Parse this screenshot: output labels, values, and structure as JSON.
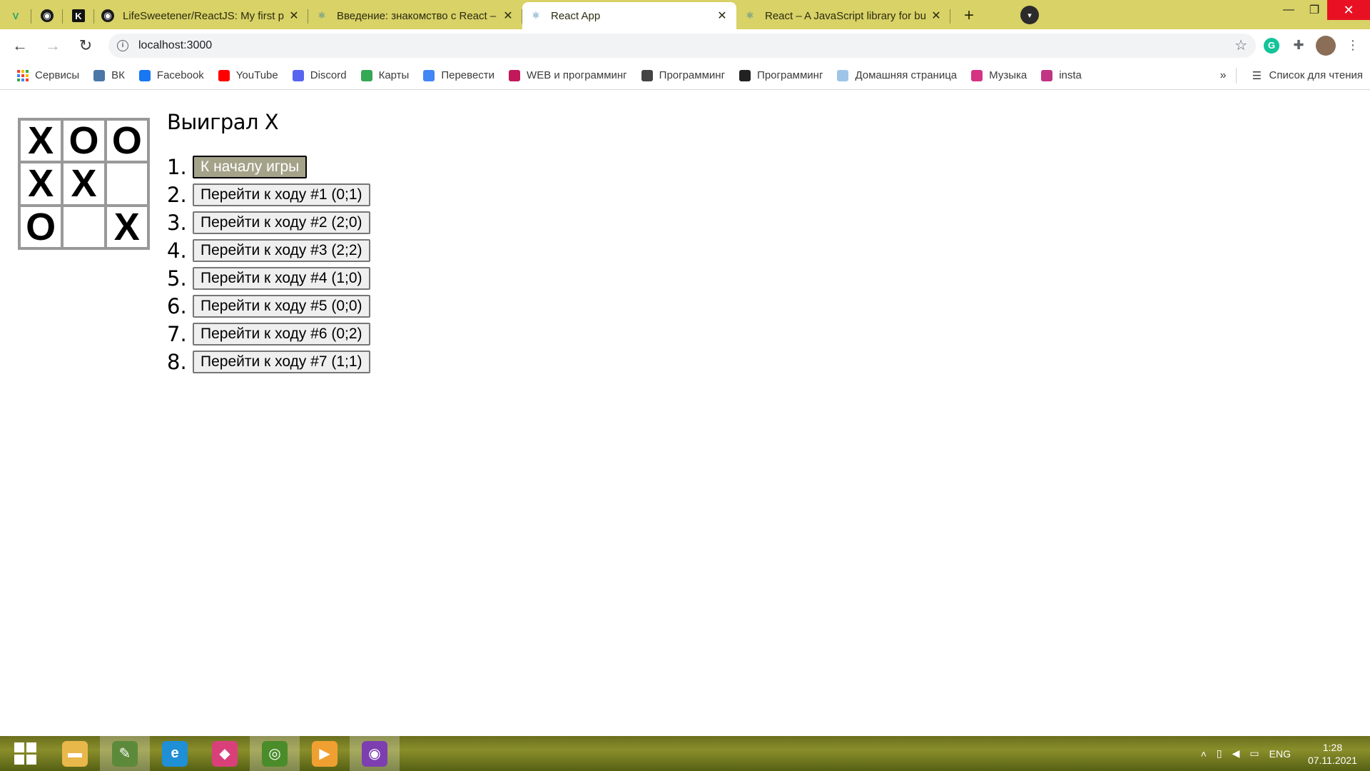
{
  "browser": {
    "tabs": [
      {
        "kind": "pinned",
        "icon": "vuetify-icon",
        "glyph": "V"
      },
      {
        "kind": "pinned",
        "icon": "github-icon",
        "glyph": "◉"
      },
      {
        "kind": "pinned",
        "icon": "kinopoisk-icon",
        "glyph": "K"
      },
      {
        "kind": "normal",
        "icon": "github-icon",
        "glyph": "◉",
        "title": "LifeSweetener/ReactJS: My first p",
        "active": false
      },
      {
        "kind": "normal",
        "icon": "react-icon",
        "glyph": "⚛",
        "title": "Введение: знакомство с React –",
        "active": false
      },
      {
        "kind": "normal",
        "icon": "react-icon",
        "glyph": "⚛",
        "title": "React App",
        "active": true
      },
      {
        "kind": "normal",
        "icon": "react-icon",
        "glyph": "⚛",
        "title": "React – A JavaScript library for bu",
        "active": false
      }
    ],
    "close_glyph": "✕",
    "new_tab_glyph": "+",
    "window": {
      "minimize": "—",
      "restore": "❐",
      "close": "✕"
    },
    "profile_glyph": "▾",
    "address": {
      "url": "localhost:3000"
    },
    "nav": {
      "back": "←",
      "forward": "→",
      "reload": "↻"
    },
    "bookmarks": [
      {
        "icon": "apps-icon",
        "label": "Сервисы",
        "color": "#4285f4"
      },
      {
        "icon": "vk-icon",
        "label": "ВК",
        "color": "#4a76a8"
      },
      {
        "icon": "facebook-icon",
        "label": "Facebook",
        "color": "#1877f2"
      },
      {
        "icon": "youtube-icon",
        "label": "YouTube",
        "color": "#ff0000"
      },
      {
        "icon": "discord-icon",
        "label": "Discord",
        "color": "#5865f2"
      },
      {
        "icon": "maps-icon",
        "label": "Карты",
        "color": "#34a853"
      },
      {
        "icon": "translate-icon",
        "label": "Перевести",
        "color": "#4285f4"
      },
      {
        "icon": "folder-icon",
        "label": "WEB и программинг",
        "color": "#c2185b"
      },
      {
        "icon": "mail-icon",
        "label": "Программинг",
        "color": "#444444"
      },
      {
        "icon": "globe-icon",
        "label": "Программинг",
        "color": "#222222"
      },
      {
        "icon": "home-page-icon",
        "label": "Домашняя страница",
        "color": "#9ec5e8"
      },
      {
        "icon": "music-icon",
        "label": "Музыка",
        "color": "#d63384"
      },
      {
        "icon": "instagram-icon",
        "label": "insta",
        "color": "#c13584"
      }
    ],
    "bookmarks_more": "»",
    "reading_list": "Список для чтения"
  },
  "game": {
    "status": "Выиграл X",
    "board": [
      "X",
      "O",
      "O",
      "X",
      "X",
      "",
      "O",
      "",
      "X"
    ],
    "moves": [
      {
        "num": "1.",
        "label": "К началу игры"
      },
      {
        "num": "2.",
        "label": "Перейти к ходу #1 (0;1)"
      },
      {
        "num": "3.",
        "label": "Перейти к ходу #2 (2;0)"
      },
      {
        "num": "4.",
        "label": "Перейти к ходу #3 (2;2)"
      },
      {
        "num": "5.",
        "label": "Перейти к ходу #4 (1;0)"
      },
      {
        "num": "6.",
        "label": "Перейти к ходу #5 (0;0)"
      },
      {
        "num": "7.",
        "label": "Перейти к ходу #6 (0;2)"
      },
      {
        "num": "8.",
        "label": "Перейти к ходу #7 (1;1)"
      }
    ]
  },
  "taskbar": {
    "apps": [
      {
        "name": "start-button",
        "kind": "start"
      },
      {
        "name": "file-explorer-icon",
        "glyph": "▬",
        "color": "#e8b84a",
        "active": false
      },
      {
        "name": "notepad-icon",
        "glyph": "✎",
        "color": "#5c8a3a",
        "active": true
      },
      {
        "name": "edge-icon",
        "glyph": "e",
        "color": "#1f8fd6",
        "active": false
      },
      {
        "name": "gem-app-icon",
        "glyph": "◆",
        "color": "#d9407a",
        "active": false
      },
      {
        "name": "chrome-icon",
        "glyph": "◎",
        "color": "#4a8c2a",
        "active": true
      },
      {
        "name": "media-player-icon",
        "glyph": "▶",
        "color": "#f0a030",
        "active": false
      },
      {
        "name": "github-desktop-icon",
        "glyph": "◉",
        "color": "#7d3fb0",
        "active": true
      }
    ],
    "tray": {
      "lang": "ENG",
      "time": "1:28",
      "date": "07.11.2021"
    }
  }
}
